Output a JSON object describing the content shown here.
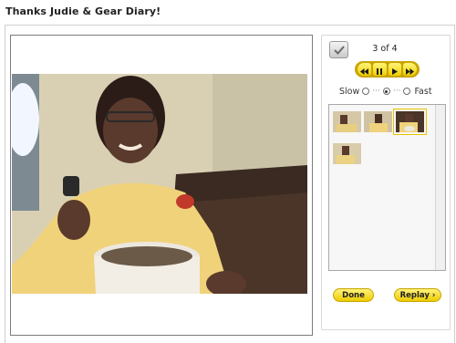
{
  "page": {
    "title": "Thanks Judie & Gear Diary!"
  },
  "slideshow": {
    "counter": "3 of 4",
    "controls": [
      {
        "name": "rewind-icon",
        "glyph": "<<"
      },
      {
        "name": "pause-icon",
        "glyph": "II"
      },
      {
        "name": "play-icon",
        "glyph": "▶"
      },
      {
        "name": "fast-forward-icon",
        "glyph": ">>"
      }
    ],
    "speed": {
      "slow_label": "Slow",
      "fast_label": "Fast",
      "separator": "···",
      "selected": "medium"
    },
    "thumbnails": {
      "count": 4,
      "selected_index": 2
    },
    "done_label": "Done",
    "replay_label": "Replay ›"
  },
  "colors": {
    "accent_yellow": "#f5d400",
    "accent_border": "#c8a400",
    "panel_border": "#d8d8d8"
  }
}
